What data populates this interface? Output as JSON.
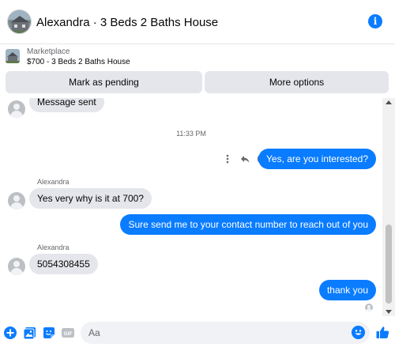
{
  "header": {
    "title": "Alexandra · 3 Beds 2 Baths House",
    "info_icon": "info-icon",
    "info_glyph": "i"
  },
  "marketplace": {
    "label": "Marketplace",
    "item": "$700 - 3 Beds 2 Baths House",
    "pending_label": "Mark as pending",
    "more_label": "More options"
  },
  "messages": {
    "m1": "Message sent",
    "timestamp": "11:33 PM",
    "m2": "Yes, are you interested?",
    "sender1": "Alexandra",
    "m3": "Yes very why is it at 700?",
    "m4": "Sure send me to your contact number to reach out of you",
    "sender2": "Alexandra",
    "m5": "5054308455",
    "m6": "thank you"
  },
  "composer": {
    "placeholder": "Aa"
  },
  "colors": {
    "accent": "#0a7cff",
    "incoming_bubble": "#e4e6eb",
    "button_bg": "#e4e6eb"
  }
}
